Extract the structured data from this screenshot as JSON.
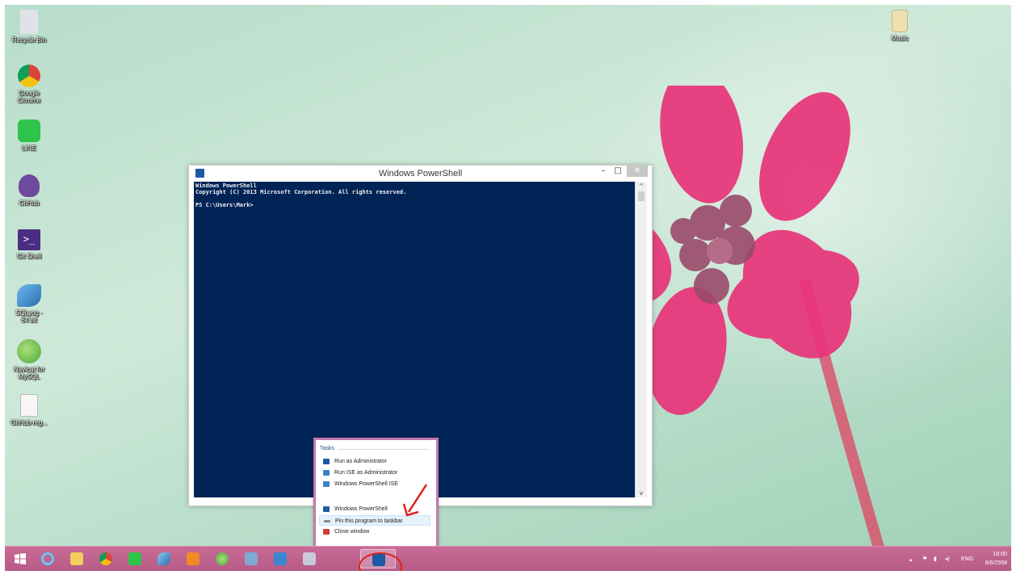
{
  "desktop": {
    "icons": [
      {
        "name": "Recycle Bin",
        "icon": "recycle-bin-icon",
        "color": "#d9dde2"
      },
      {
        "name": "Google Chrome",
        "icon": "chrome-icon",
        "color": "#e0453a"
      },
      {
        "name": "LINE",
        "icon": "line-icon",
        "color": "#2ec44a"
      },
      {
        "name": "GitHub",
        "icon": "github-icon",
        "color": "#6e4a9e"
      },
      {
        "name": "Git Shell",
        "icon": "git-shell-icon",
        "color": "#4a2d82"
      },
      {
        "name": "SQLyog - 64 bit",
        "icon": "sqlyog-icon",
        "color": "#3a8fd0"
      },
      {
        "name": "Navicat for MySQL",
        "icon": "navicat-icon",
        "color": "#5fb944"
      },
      {
        "name": "GitHub-reg...",
        "icon": "document-icon",
        "color": "#f4f4f4"
      }
    ],
    "right_icon": {
      "name": "Music",
      "icon": "music-folder-icon",
      "color": "#e8d9a0"
    }
  },
  "powershell": {
    "title": "Windows PowerShell",
    "console_lines": [
      "Windows PowerShell",
      "Copyright (C) 2013 Microsoft Corporation. All rights reserved.",
      "",
      "PS C:\\Users\\Mark>"
    ],
    "minimize": "–",
    "maximize": "□",
    "close": "✕",
    "console_bg": "#012456"
  },
  "jumplist": {
    "header": "Tasks",
    "tasks": [
      {
        "label": "Run as Administrator",
        "icon": "powershell-icon"
      },
      {
        "label": "Run ISE as Administrator",
        "icon": "powershell-ise-icon"
      },
      {
        "label": "Windows PowerShell ISE",
        "icon": "powershell-ise-icon"
      }
    ],
    "actions": [
      {
        "label": "Windows PowerShell",
        "icon": "powershell-icon"
      },
      {
        "label": "Pin this program to taskbar",
        "icon": "pin-icon"
      },
      {
        "label": "Close window",
        "icon": "close-window-icon"
      }
    ]
  },
  "taskbar": {
    "apps": [
      {
        "name": "start",
        "icon": "windows-start-icon"
      },
      {
        "name": "ie",
        "icon": "internet-explorer-icon"
      },
      {
        "name": "explorer",
        "icon": "file-explorer-icon"
      },
      {
        "name": "chrome",
        "icon": "chrome-icon"
      },
      {
        "name": "line",
        "icon": "line-icon"
      },
      {
        "name": "sqlyog",
        "icon": "sqlyog-icon"
      },
      {
        "name": "media",
        "icon": "media-player-icon"
      },
      {
        "name": "navicat",
        "icon": "navicat-icon"
      },
      {
        "name": "misc",
        "icon": "app-icon"
      },
      {
        "name": "remote",
        "icon": "remote-desktop-icon"
      },
      {
        "name": "tools",
        "icon": "tools-icon"
      },
      {
        "name": "powershell",
        "icon": "powershell-icon"
      }
    ],
    "tray": {
      "lang": "ENG",
      "time": "18:00",
      "date": "8/6/2558"
    },
    "bg": "#c2668f"
  }
}
